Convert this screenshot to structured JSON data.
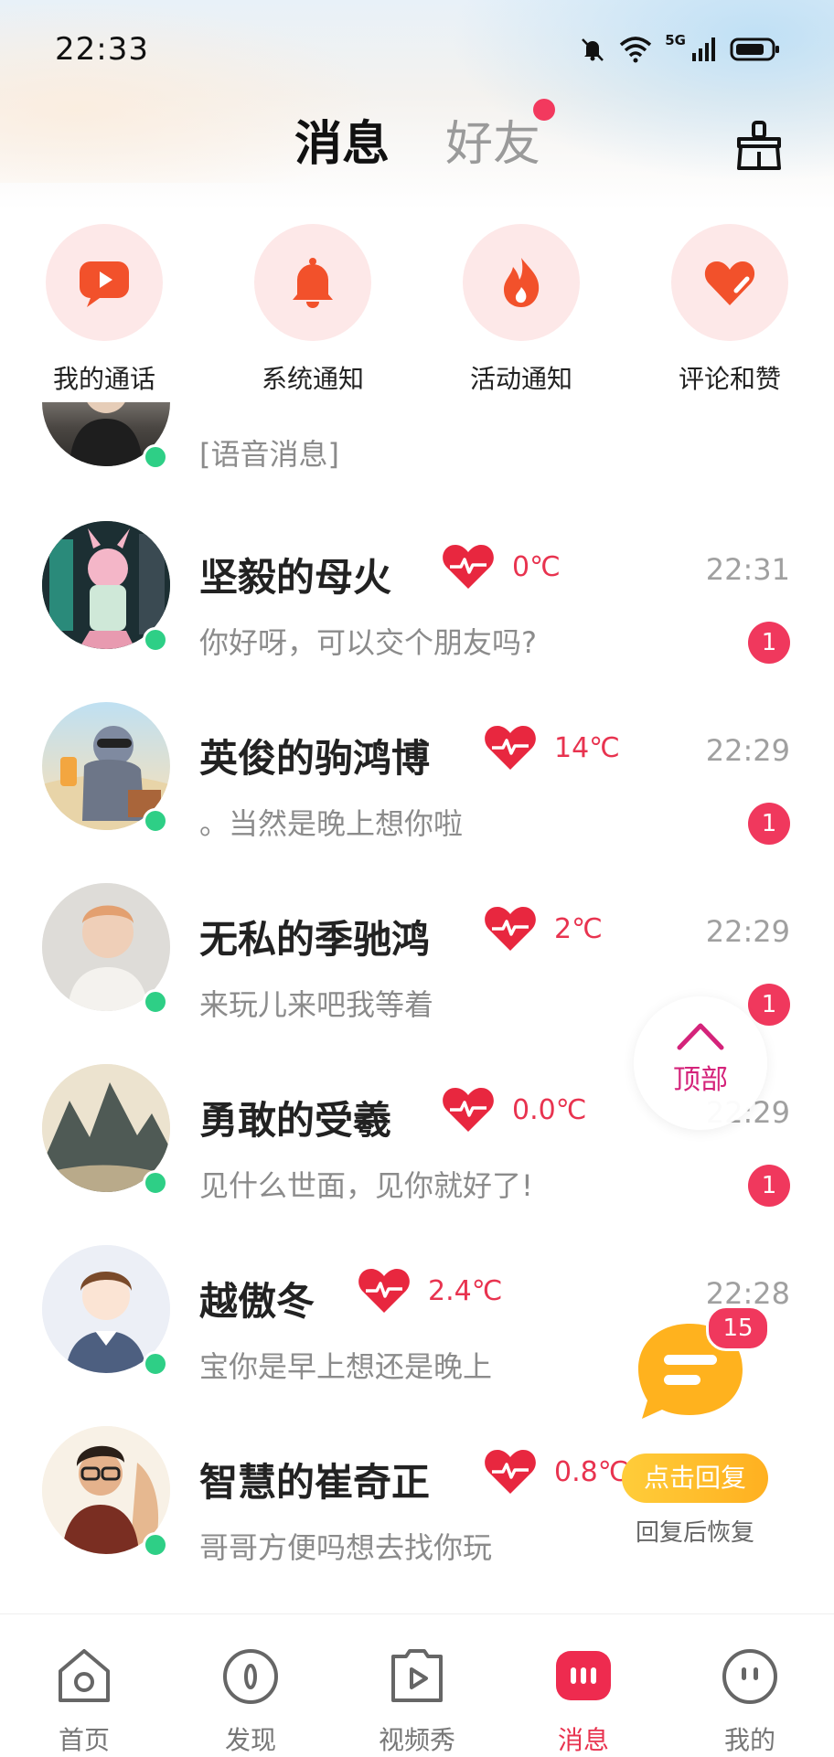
{
  "status_bar": {
    "time": "22:33",
    "network": "5G"
  },
  "header": {
    "tabs": [
      {
        "label": "消息"
      },
      {
        "label": "好友"
      }
    ]
  },
  "shortcuts": [
    {
      "label": "我的通话",
      "icon": "video-call-icon"
    },
    {
      "label": "系统通知",
      "icon": "bell-icon"
    },
    {
      "label": "活动通知",
      "icon": "flame-icon"
    },
    {
      "label": "评论和赞",
      "icon": "heart-edit-icon"
    }
  ],
  "partial_message": {
    "preview": "[语音消息]"
  },
  "conversations": [
    {
      "name": "坚毅的母火",
      "temp": "0℃",
      "preview": "你好呀，可以交个朋友吗?",
      "time": "22:31",
      "unread": "1"
    },
    {
      "name": "英俊的驹鸿博",
      "temp": "14℃",
      "preview": "。当然是晚上想你啦",
      "time": "22:29",
      "unread": "1"
    },
    {
      "name": "无私的季驰鸿",
      "temp": "2℃",
      "preview": "来玩儿来吧我等着",
      "time": "22:29",
      "unread": "1"
    },
    {
      "name": "勇敢的受羲",
      "temp": "0.0℃",
      "preview": "见什么世面，见你就好了!",
      "time": "22:29",
      "unread": "1"
    },
    {
      "name": "越傲冬",
      "temp": "2.4℃",
      "preview": "宝你是早上想还是晚上",
      "time": "22:28",
      "unread": ""
    },
    {
      "name": "智慧的崔奇正",
      "temp": "0.8℃",
      "preview": "哥哥方便吗想去找你玩",
      "time": "",
      "unread": ""
    }
  ],
  "floating": {
    "top_label": "顶部",
    "reply_count": "15",
    "reply_button": "点击回复",
    "reply_sub": "回复后恢复"
  },
  "bottom_nav": [
    {
      "label": "首页"
    },
    {
      "label": "发现"
    },
    {
      "label": "视频秀"
    },
    {
      "label": "消息"
    },
    {
      "label": "我的"
    }
  ],
  "colors": {
    "accent": "#e8334f",
    "badge": "#f0385d",
    "online": "#2ecf86",
    "tab_highlight": "#e08cf4"
  }
}
